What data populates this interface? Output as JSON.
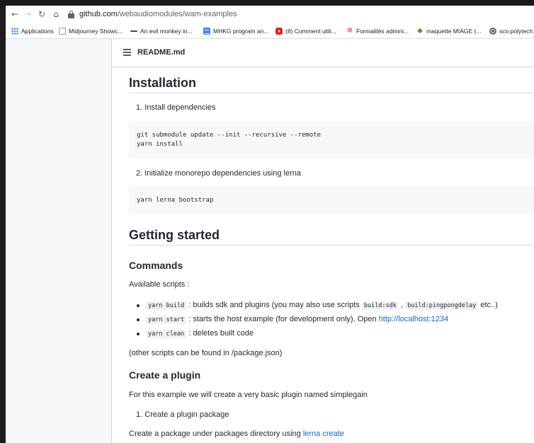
{
  "browser": {
    "url_host": "github.com",
    "url_path": "/webaudiomodules/wam-examples",
    "bookmarks": [
      {
        "label": "Applications",
        "icon": "apps-grid-icon"
      },
      {
        "label": "Midjourney Showc...",
        "icon": "midjourney-icon"
      },
      {
        "label": "An evil monkey in...",
        "icon": "monkey-icon"
      },
      {
        "label": "MHKG program an...",
        "icon": "google-docs-icon"
      },
      {
        "label": "(8) Comment utili...",
        "icon": "youtube-icon"
      },
      {
        "label": "Formalités admini...",
        "icon": "star-logo-icon"
      },
      {
        "label": "maquette MIAGE (...",
        "icon": "diamond-logo-icon"
      },
      {
        "label": "sco.polytech.u",
        "icon": "globe-icon"
      }
    ]
  },
  "file_header": {
    "name": "README.md",
    "icon": "list-icon"
  },
  "readme": {
    "installation_title": "Installation",
    "step1_num": "1.",
    "step1": "Install dependencies",
    "code1_line1": "git submodule update --init --recursive --remote",
    "code1_line2": "yarn install",
    "step2_num": "2.",
    "step2": "Initialize monorepo dependencies using lerna",
    "code2_line1": "yarn lerna bootstrap",
    "getting_started_title": "Getting started",
    "commands_title": "Commands",
    "available_scripts": "Available scripts :",
    "b1_code": "yarn build",
    "b1_text": ": builds sdk and plugins (you may also use scripts",
    "b1_code2": "build:sdk",
    "b1_comma": ",",
    "b1_code3": "build:pingpongdelay",
    "b1_end": "etc..)",
    "b2_code": "yarn start",
    "b2_text": ": starts the host example (for development only). Open",
    "b2_link": "http://localhost:1234",
    "b3_code": "yarn clean",
    "b3_text": ": deletes built code",
    "other_scripts": "(other scripts can be found in /package.json)",
    "create_plugin_title": "Create a plugin",
    "example_text": "For this example we will create a very basic plugin named simplegain",
    "step3_num": "1.",
    "step3": "Create a plugin package",
    "create_package_text": "Create a package under packages directory using",
    "create_package_link": "lerna create"
  },
  "colors": {
    "link": "#0969da",
    "text": "#24292f",
    "code_bg": "#f6f8fa"
  }
}
